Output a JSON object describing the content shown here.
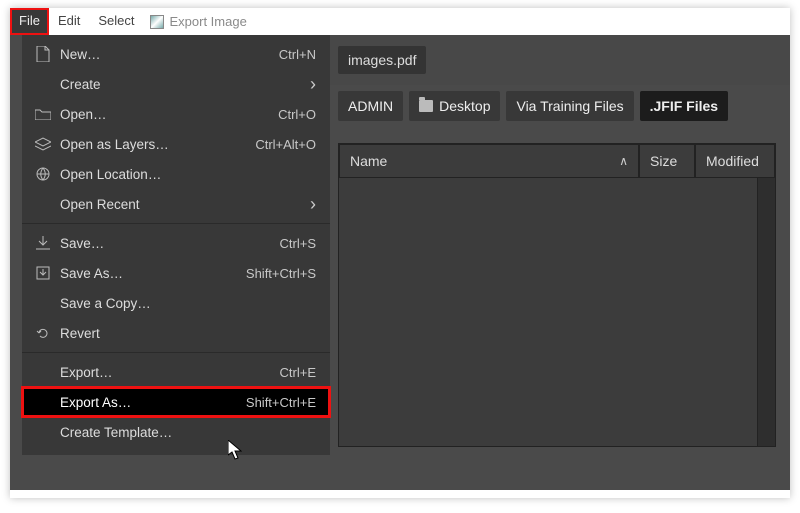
{
  "menubar": {
    "items": [
      "File",
      "Edit",
      "Select"
    ],
    "title": "Export Image"
  },
  "file_menu": {
    "items": [
      {
        "label": "New…",
        "accel": "Ctrl+N",
        "icon": "new"
      },
      {
        "label": "Create",
        "submenu": true
      },
      {
        "label": "Open…",
        "accel": "Ctrl+O",
        "icon": "open"
      },
      {
        "label": "Open as Layers…",
        "accel": "Ctrl+Alt+O",
        "icon": "layers"
      },
      {
        "label": "Open Location…",
        "icon": "globe"
      },
      {
        "label": "Open Recent",
        "submenu": true
      },
      {
        "sep": true
      },
      {
        "label": "Save…",
        "accel": "Ctrl+S",
        "icon": "save"
      },
      {
        "label": "Save As…",
        "accel": "Shift+Ctrl+S",
        "icon": "saveas"
      },
      {
        "label": "Save a Copy…"
      },
      {
        "label": "Revert",
        "icon": "revert"
      },
      {
        "sep": true
      },
      {
        "label": "Export…",
        "accel": "Ctrl+E"
      },
      {
        "label": "Export As…",
        "accel": "Shift+Ctrl+E",
        "highlight": true
      },
      {
        "label": "Create Template…"
      }
    ]
  },
  "tabs": [
    {
      "label": "images.pdf"
    }
  ],
  "breadcrumbs": [
    {
      "label": "ADMIN"
    },
    {
      "label": "Desktop",
      "folder_icon": true
    },
    {
      "label": "Via Training Files"
    },
    {
      "label": ".JFIF Files",
      "active": true
    }
  ],
  "file_list": {
    "columns": {
      "name": "Name",
      "size": "Size",
      "modified": "Modified"
    },
    "rows": []
  }
}
